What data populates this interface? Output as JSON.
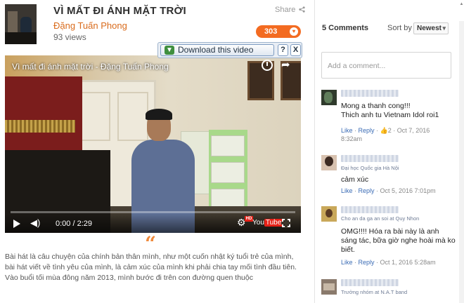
{
  "video": {
    "title": "VÌ MẤT ĐI ÁNH MẶT TRỜI",
    "author": "Đặng Tuấn Phong",
    "views": "93 views",
    "share_label": "Share",
    "like_count": "303",
    "download_label": "Download this video",
    "help_label": "?",
    "close_label": "X",
    "player": {
      "overlay_title": "Vì mất đi ánh mặt trời - Đặng Tuấn Phong",
      "time": "0:00 / 2:29",
      "progress": 0,
      "youtube_label_you": "You",
      "youtube_label_tube": "Tube",
      "hd_label": "HD"
    },
    "quote_mark": "“",
    "description": "Bài hát là câu chuyện của chính bản thân mình, như một cuốn nhật ký tuổi trẻ của mình, bài hát viết về tình yêu của mình, là cảm xúc của mình khi phải chia tay mối tình đầu tiên. Vào buổi tối mùa đông năm 2013, mình bước đi trên con đường quen thuộc"
  },
  "comments_panel": {
    "count_label": "5 Comments",
    "sort_label": "Sort by",
    "sort_value": "Newest",
    "input_placeholder": "Add a comment...",
    "comments": [
      {
        "subtitle": "",
        "text": "Mong a thanh cong!!!\nThich anh tu Vietnam Idol roi1",
        "like": "Like",
        "reply": "Reply",
        "likes_count": "2",
        "date": "Oct 7, 2016\n8:32am"
      },
      {
        "subtitle": "Đại học Quốc gia Hà Nội",
        "text": "cảm xúc",
        "like": "Like",
        "reply": "Reply",
        "likes_count": "",
        "date": "Oct 5, 2016 7:01pm"
      },
      {
        "subtitle": "Cho an da ga an soi at Quy Nhon",
        "text": "OMG!!!! Hóa ra bài này là anh sáng tác, bữa giờ nghe hoài mà ko biết.",
        "like": "Like",
        "reply": "Reply",
        "likes_count": "",
        "date": "Oct 1, 2016 5:28am"
      },
      {
        "subtitle": "Trưởng nhóm at N.A.T band",
        "text": "",
        "like": "",
        "reply": "",
        "likes_count": "",
        "date": ""
      }
    ]
  },
  "colors": {
    "accent_orange": "#f36b21",
    "author_orange": "#d96b1c",
    "link_blue": "#3b6cb5",
    "youtube_red": "#e62117"
  },
  "icons": [
    "share-icon",
    "heart-icon",
    "download-arrow-icon",
    "watch-later-icon",
    "video-share-icon",
    "play-icon",
    "volume-icon",
    "settings-gear-icon",
    "fullscreen-icon",
    "quote-icon",
    "dropdown-caret-icon"
  ]
}
